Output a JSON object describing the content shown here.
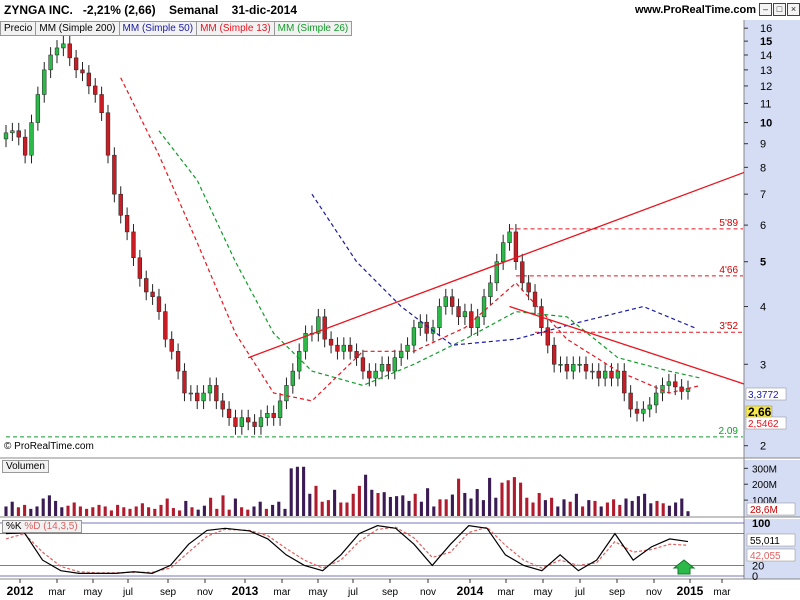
{
  "header": {
    "symbol": "ZYNGA INC.",
    "change": "-2,21% (2,66)",
    "period": "Semanal",
    "date": "31-dic-2014",
    "site": "www.ProRealTime.com"
  },
  "legend": {
    "price": "Precio",
    "ma200": "MM (Simple 200)",
    "ma50": "MM (Simple 50)",
    "ma13": "MM (Simple 13)",
    "ma26": "MM (Simple 26)"
  },
  "watermark": "© ProRealTime.com",
  "colors": {
    "ma50": "#1a1aa8",
    "ma13": "#e8141e",
    "ma26": "#129b2a",
    "up_candle": "#2db84a",
    "down_candle": "#c81d24",
    "volume_up": "#3a1b53",
    "volume_down": "#b01c2e",
    "right_axis_bg": "#d5ddf5",
    "stoch_k": "#000000",
    "stoch_d": "#e06060"
  },
  "chart_data": [
    {
      "type": "candlestick",
      "panel": "price",
      "yscale": "log",
      "ylim": [
        1.9,
        16.5
      ],
      "y_ticks": [
        "16",
        "15",
        "14",
        "13",
        "12",
        "11",
        "10",
        "9",
        "8",
        "7",
        "6",
        "5",
        "4",
        "3",
        "2"
      ],
      "bold_y_ticks": [
        "15",
        "10",
        "5"
      ],
      "x_labels": [
        "2012",
        "mar",
        "may",
        "jul",
        "sep",
        "nov",
        "2013",
        "mar",
        "may",
        "jul",
        "sep",
        "nov",
        "2014",
        "mar",
        "may",
        "jul",
        "sep",
        "nov",
        "2015",
        "mar"
      ],
      "bold_x_labels": [
        "2012",
        "2013",
        "2014",
        "2015"
      ],
      "close_series": [
        9.5,
        9.6,
        9.3,
        8.5,
        10,
        11.5,
        13,
        14,
        14.5,
        14.8,
        13.8,
        13,
        12.8,
        12,
        11.5,
        10.5,
        8.5,
        7,
        6.3,
        5.8,
        5.1,
        4.6,
        4.3,
        4.2,
        3.9,
        3.4,
        3.2,
        2.9,
        2.6,
        2.6,
        2.5,
        2.6,
        2.7,
        2.5,
        2.4,
        2.3,
        2.2,
        2.3,
        2.25,
        2.2,
        2.3,
        2.35,
        2.3,
        2.5,
        2.7,
        2.9,
        3.2,
        3.5,
        3.5,
        3.8,
        3.4,
        3.3,
        3.2,
        3.3,
        3.2,
        3.1,
        2.9,
        2.8,
        2.9,
        3.0,
        2.9,
        3.1,
        3.2,
        3.3,
        3.6,
        3.7,
        3.5,
        3.6,
        4.0,
        4.2,
        4.0,
        3.8,
        3.9,
        3.6,
        3.8,
        4.2,
        4.5,
        5.0,
        5.5,
        5.8,
        5.0,
        4.5,
        4.3,
        4.0,
        3.6,
        3.3,
        3.0,
        3.0,
        2.9,
        3.0,
        3.0,
        2.9,
        2.9,
        2.8,
        2.9,
        2.8,
        2.9,
        2.6,
        2.4,
        2.35,
        2.4,
        2.45,
        2.6,
        2.7,
        2.75,
        2.68,
        2.62,
        2.66
      ],
      "moving_averages": [
        {
          "name": "MM (Simple 50)",
          "points": [
            [
              48,
              7.0
            ],
            [
              55,
              5.0
            ],
            [
              62,
              4.0
            ],
            [
              70,
              3.3
            ],
            [
              80,
              3.4
            ],
            [
              90,
              3.7
            ],
            [
              100,
              4.0
            ],
            [
              108,
              3.6
            ]
          ]
        },
        {
          "name": "MM (Simple 13)",
          "points": [
            [
              18,
              12.5
            ],
            [
              24,
              8.5
            ],
            [
              30,
              5.5
            ],
            [
              36,
              3.5
            ],
            [
              42,
              2.6
            ],
            [
              48,
              2.5
            ],
            [
              56,
              3.2
            ],
            [
              64,
              3.2
            ],
            [
              72,
              3.6
            ],
            [
              80,
              4.5
            ],
            [
              88,
              3.4
            ],
            [
              96,
              2.9
            ],
            [
              104,
              2.6
            ],
            [
              109,
              2.7
            ]
          ]
        },
        {
          "name": "MM (Simple 26)",
          "points": [
            [
              24,
              9.6
            ],
            [
              30,
              7.5
            ],
            [
              36,
              5.0
            ],
            [
              42,
              3.5
            ],
            [
              48,
              2.9
            ],
            [
              56,
              2.7
            ],
            [
              64,
              3.0
            ],
            [
              72,
              3.4
            ],
            [
              80,
              3.9
            ],
            [
              88,
              3.8
            ],
            [
              96,
              3.1
            ],
            [
              104,
              2.9
            ],
            [
              109,
              2.8
            ]
          ]
        }
      ],
      "trendlines": [
        {
          "from": [
            38,
            3.1
          ],
          "to": [
            117,
            7.8
          ]
        },
        {
          "from": [
            79,
            4.0
          ],
          "to": [
            117,
            2.72
          ]
        }
      ],
      "horizontal_levels": [
        {
          "label": "5'89",
          "value": 5.89,
          "start": 79
        },
        {
          "label": "4'66",
          "value": 4.66,
          "start": 80
        },
        {
          "label": "3'52",
          "value": 3.52,
          "start": 83
        },
        {
          "label": "2.09",
          "value": 2.09,
          "start": 0
        }
      ],
      "right_markers": [
        {
          "label": "3,3772",
          "value": 3.3772
        },
        {
          "label": "2,66",
          "value": 2.66
        },
        {
          "label": "2,5462",
          "value": 2.5462
        }
      ]
    },
    {
      "type": "bar",
      "panel": "volume",
      "title": "Volumen",
      "y_ticks": [
        "300M",
        "200M",
        "100M"
      ],
      "last_value": "28,6M",
      "values_m": [
        60,
        90,
        55,
        70,
        45,
        60,
        110,
        130,
        95,
        55,
        65,
        85,
        60,
        45,
        55,
        70,
        60,
        35,
        70,
        55,
        45,
        60,
        80,
        55,
        45,
        70,
        110,
        50,
        35,
        95,
        55,
        40,
        65,
        115,
        45,
        130,
        40,
        110,
        55,
        40,
        60,
        90,
        45,
        70,
        90,
        45,
        300,
        310,
        310,
        140,
        190,
        90,
        100,
        165,
        85,
        85,
        140,
        190,
        260,
        165,
        145,
        150,
        120,
        125,
        130,
        95,
        140,
        90,
        175,
        60,
        105,
        105,
        135,
        235,
        145,
        110,
        170,
        100,
        240,
        115,
        210,
        225,
        245,
        210,
        115,
        85,
        145,
        100,
        115,
        60,
        105,
        90,
        140,
        60,
        100,
        95,
        60,
        85,
        105,
        70,
        110,
        95,
        125,
        140,
        80,
        95,
        80,
        65,
        85,
        110,
        30
      ],
      "ylim": [
        0,
        340
      ]
    },
    {
      "type": "line",
      "panel": "stochastic",
      "series_names": [
        "%K",
        "%D (14,3,5)"
      ],
      "y_ticks": [
        "100",
        "20",
        "0"
      ],
      "k_values": [
        [
          0,
          80
        ],
        [
          3,
          82
        ],
        [
          6,
          30
        ],
        [
          9,
          10
        ],
        [
          12,
          5
        ],
        [
          15,
          5
        ],
        [
          18,
          5
        ],
        [
          21,
          8
        ],
        [
          24,
          5
        ],
        [
          27,
          20
        ],
        [
          30,
          60
        ],
        [
          33,
          86
        ],
        [
          36,
          90
        ],
        [
          40,
          85
        ],
        [
          43,
          70
        ],
        [
          46,
          40
        ],
        [
          49,
          20
        ],
        [
          52,
          10
        ],
        [
          55,
          40
        ],
        [
          58,
          80
        ],
        [
          61,
          95
        ],
        [
          64,
          90
        ],
        [
          67,
          60
        ],
        [
          70,
          20
        ],
        [
          73,
          60
        ],
        [
          76,
          95
        ],
        [
          79,
          90
        ],
        [
          82,
          40
        ],
        [
          85,
          20
        ],
        [
          88,
          10
        ],
        [
          91,
          40
        ],
        [
          94,
          10
        ],
        [
          97,
          30
        ],
        [
          100,
          80
        ],
        [
          103,
          30
        ],
        [
          106,
          55
        ],
        [
          109,
          70
        ],
        [
          112,
          65
        ]
      ],
      "d_values": [
        [
          0,
          70
        ],
        [
          3,
          80
        ],
        [
          6,
          45
        ],
        [
          9,
          18
        ],
        [
          12,
          8
        ],
        [
          15,
          6
        ],
        [
          18,
          6
        ],
        [
          21,
          7
        ],
        [
          24,
          7
        ],
        [
          27,
          15
        ],
        [
          30,
          45
        ],
        [
          33,
          75
        ],
        [
          36,
          88
        ],
        [
          40,
          86
        ],
        [
          43,
          76
        ],
        [
          46,
          52
        ],
        [
          49,
          30
        ],
        [
          52,
          15
        ],
        [
          55,
          30
        ],
        [
          58,
          65
        ],
        [
          61,
          88
        ],
        [
          64,
          92
        ],
        [
          67,
          72
        ],
        [
          70,
          35
        ],
        [
          73,
          45
        ],
        [
          76,
          82
        ],
        [
          79,
          92
        ],
        [
          82,
          58
        ],
        [
          85,
          30
        ],
        [
          88,
          15
        ],
        [
          91,
          30
        ],
        [
          94,
          20
        ],
        [
          97,
          25
        ],
        [
          100,
          65
        ],
        [
          103,
          45
        ],
        [
          106,
          50
        ],
        [
          109,
          60
        ],
        [
          112,
          58
        ]
      ],
      "right_markers": [
        {
          "label": "55,011",
          "value": 55.011
        },
        {
          "label": "42,055",
          "value": 42.055
        }
      ]
    }
  ]
}
